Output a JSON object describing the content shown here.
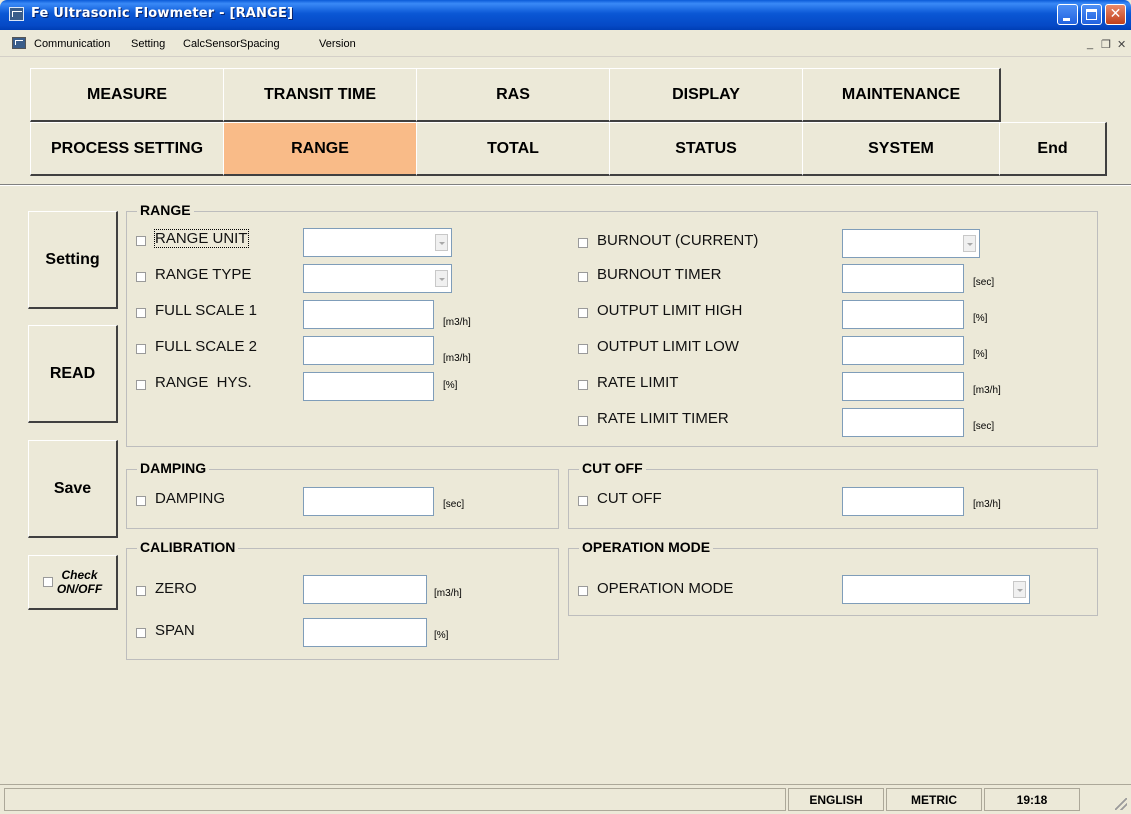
{
  "window": {
    "title": "Fe Ultrasonic Flowmeter - [RANGE]"
  },
  "menu": {
    "items": [
      "Communication",
      "Setting",
      "CalcSensorSpacing",
      "Version"
    ]
  },
  "nav": {
    "row1": [
      "MEASURE",
      "TRANSIT TIME",
      "RAS",
      "DISPLAY",
      "MAINTENANCE"
    ],
    "row2": [
      "PROCESS SETTING",
      "RANGE",
      "TOTAL",
      "STATUS",
      "SYSTEM",
      "End"
    ],
    "active": "RANGE",
    "active_color": "#f9bb88"
  },
  "side": {
    "setting": "Setting",
    "read": "READ",
    "save": "Save",
    "check_line1": "Check",
    "check_line2": "ON/OFF"
  },
  "range": {
    "title": "RANGE",
    "range_unit": "RANGE UNIT",
    "range_type": "RANGE TYPE",
    "full_scale_1": "FULL SCALE 1",
    "full_scale_1_unit": "[m3/h]",
    "full_scale_2": "FULL SCALE 2",
    "full_scale_2_unit": "[m3/h]",
    "range_hys": "RANGE  HYS.",
    "range_hys_unit": "[%]",
    "burnout_current": "BURNOUT (CURRENT)",
    "burnout_timer": "BURNOUT TIMER",
    "burnout_timer_unit": "[sec]",
    "output_limit_high": "OUTPUT LIMIT HIGH",
    "output_limit_high_unit": "[%]",
    "output_limit_low": "OUTPUT LIMIT LOW",
    "output_limit_low_unit": "[%]",
    "rate_limit": "RATE LIMIT",
    "rate_limit_unit": "[m3/h]",
    "rate_limit_timer": "RATE LIMIT TIMER",
    "rate_limit_timer_unit": "[sec]"
  },
  "damping": {
    "title": "DAMPING",
    "label": "DAMPING",
    "unit": "[sec]"
  },
  "cutoff": {
    "title": "CUT OFF",
    "label": "CUT OFF",
    "unit": "[m3/h]"
  },
  "calibration": {
    "title": "CALIBRATION",
    "zero": "ZERO",
    "zero_unit": "[m3/h]",
    "span": "SPAN",
    "span_unit": "[%]"
  },
  "operation": {
    "title": "OPERATION MODE",
    "label": "OPERATION MODE"
  },
  "status": {
    "language": "ENGLISH",
    "units": "METRIC",
    "time": "19:18"
  }
}
